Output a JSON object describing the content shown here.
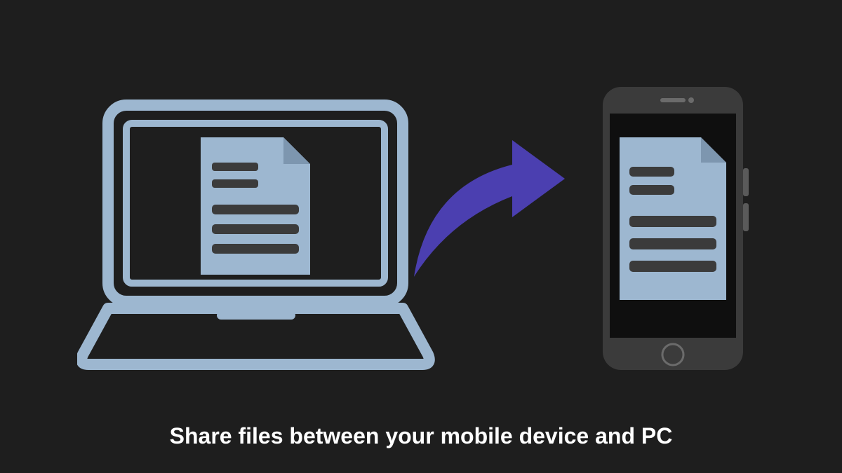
{
  "caption": "Share files between your mobile device and PC",
  "colors": {
    "background": "#1e1e1e",
    "laptop_outline": "#9db7d0",
    "document_fill": "#9db7d0",
    "document_lines": "#3b3b3b",
    "arrow": "#4b3fb0",
    "phone_body": "#3b3b3b",
    "phone_screen": "#0f0f0f"
  },
  "icons": {
    "laptop": "laptop-icon",
    "document": "document-icon",
    "arrow": "arrow-right-icon",
    "phone": "phone-icon"
  }
}
